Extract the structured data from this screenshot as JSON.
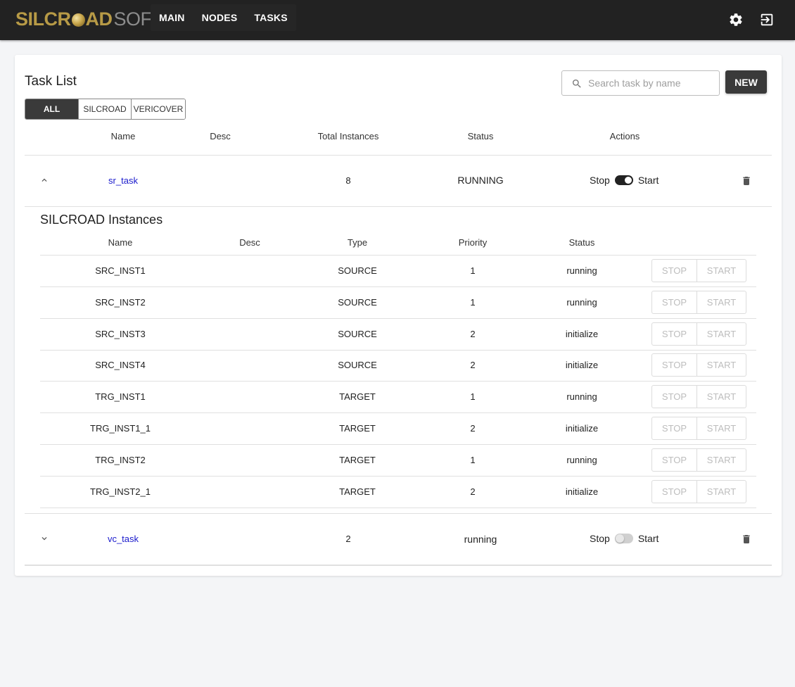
{
  "app": {
    "logo_part1": "SILCR",
    "logo_part2": "AD",
    "logo_part3": "SOFT",
    "nav": [
      "MAIN",
      "NODES",
      "TASKS"
    ],
    "settings_icon": "gear-icon",
    "logout_icon": "logout-icon"
  },
  "tasklist": {
    "title": "Task List",
    "search_placeholder": "Search task by name",
    "new_label": "NEW",
    "filters": [
      "ALL",
      "SILCROAD",
      "VERICOVER"
    ],
    "active_filter": "ALL",
    "columns": [
      "Name",
      "Desc",
      "Total Instances",
      "Status",
      "Actions"
    ],
    "stop_label": "Stop",
    "start_label": "Start",
    "tasks": [
      {
        "name": "sr_task",
        "desc": "",
        "total": "8",
        "status": "RUNNING",
        "toggle_on": true,
        "expanded": true
      },
      {
        "name": "vc_task",
        "desc": "",
        "total": "2",
        "status": "running",
        "toggle_on": false,
        "expanded": false
      }
    ]
  },
  "instances": {
    "title": "SILCROAD Instances",
    "columns": [
      "Name",
      "Desc",
      "Type",
      "Priority",
      "Status"
    ],
    "stop_label": "STOP",
    "start_label": "START",
    "rows": [
      {
        "name": "SRC_INST1",
        "desc": "",
        "type": "SOURCE",
        "priority": "1",
        "status": "running"
      },
      {
        "name": "SRC_INST2",
        "desc": "",
        "type": "SOURCE",
        "priority": "1",
        "status": "running"
      },
      {
        "name": "SRC_INST3",
        "desc": "",
        "type": "SOURCE",
        "priority": "2",
        "status": "initialize"
      },
      {
        "name": "SRC_INST4",
        "desc": "",
        "type": "SOURCE",
        "priority": "2",
        "status": "initialize"
      },
      {
        "name": "TRG_INST1",
        "desc": "",
        "type": "TARGET",
        "priority": "1",
        "status": "running"
      },
      {
        "name": "TRG_INST1_1",
        "desc": "",
        "type": "TARGET",
        "priority": "2",
        "status": "initialize"
      },
      {
        "name": "TRG_INST2",
        "desc": "",
        "type": "TARGET",
        "priority": "1",
        "status": "running"
      },
      {
        "name": "TRG_INST2_1",
        "desc": "",
        "type": "TARGET",
        "priority": "2",
        "status": "initialize"
      }
    ]
  }
}
